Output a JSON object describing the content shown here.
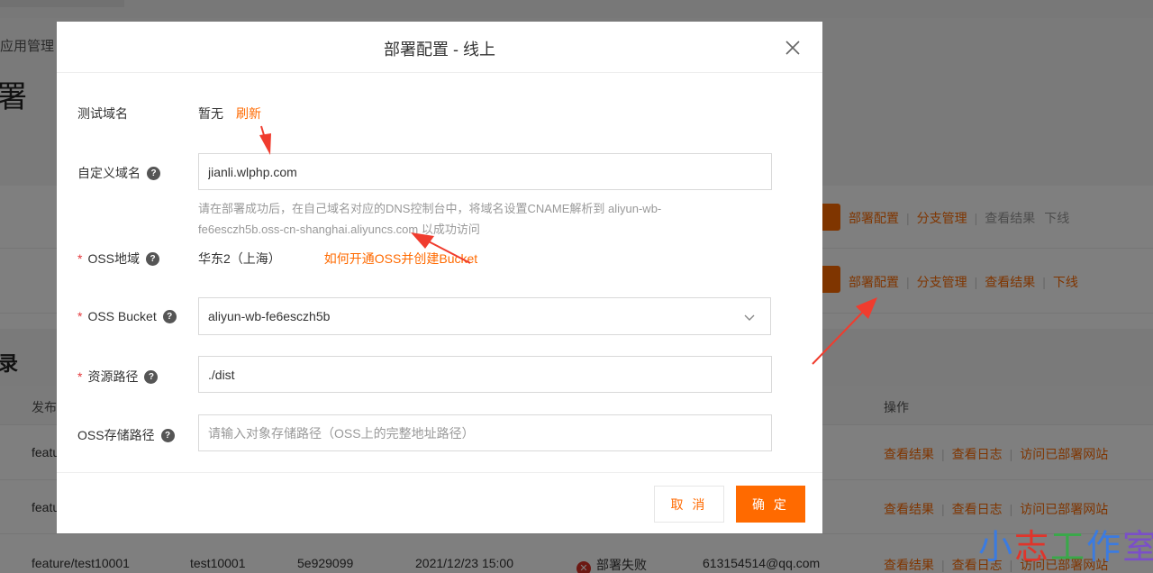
{
  "background": {
    "breadcrumb": "应用管理",
    "page_title_fragment": "署",
    "section_title_fragment": "录",
    "rows": [
      {
        "actions": [
          {
            "label": "部署配置",
            "style": "orange"
          },
          {
            "label": "分支管理",
            "style": "orange"
          },
          {
            "label": "查看结果",
            "style": "gray"
          },
          {
            "label": "下线",
            "style": "gray"
          }
        ]
      },
      {
        "actions": [
          {
            "label": "部署配置",
            "style": "orange"
          },
          {
            "label": "分支管理",
            "style": "orange"
          },
          {
            "label": "查看结果",
            "style": "orange"
          },
          {
            "label": "下线",
            "style": "orange"
          }
        ]
      }
    ],
    "table": {
      "headers": {
        "publish": "发布",
        "operation": "操作"
      },
      "row_actions": [
        "查看结果",
        "查看日志",
        "访问已部署网站"
      ],
      "rows": [
        {
          "branch": "featu"
        },
        {
          "branch": "featu"
        },
        {
          "branch": "feature/test10001",
          "name": "test10001",
          "commit": "5e929099",
          "time": "2021/12/23 15:00",
          "status": "部署失败",
          "email": "613154514@qq.com"
        }
      ]
    }
  },
  "modal": {
    "title": "部署配置 - 线上",
    "close_icon": "close-icon",
    "fields": {
      "test_domain": {
        "label": "测试域名",
        "value": "暂无",
        "link": "刷新"
      },
      "custom_domain": {
        "label": "自定义域名",
        "value": "jianli.wlphp.com",
        "hint_line1": "请在部署成功后，在自己域名对应的DNS控制台中，将域名设置CNAME解析到 aliyun-wb-",
        "hint_line2": "fe6esczh5b.oss-cn-shanghai.aliyuncs.com 以成功访问"
      },
      "oss_region": {
        "label": "OSS地域",
        "value": "华东2（上海）",
        "link": "如何开通OSS并创建Bucket"
      },
      "oss_bucket": {
        "label": "OSS Bucket",
        "value": "aliyun-wb-fe6esczh5b"
      },
      "resource_path": {
        "label": "资源路径",
        "value": "./dist"
      },
      "oss_storage_path": {
        "label": "OSS存储路径",
        "value": "",
        "placeholder": "请输入对象存储路径（OSS上的完整地址路径）"
      }
    },
    "buttons": {
      "cancel": "取 消",
      "ok": "确 定"
    }
  },
  "watermark": {
    "chars": [
      "小",
      "志",
      "工",
      "作",
      "室"
    ],
    "colors": [
      "#3b7be0",
      "#e0352b",
      "#3aa84a",
      "#3b7be0",
      "#7b4fc8"
    ]
  },
  "colors": {
    "accent": "#ff6a00",
    "required": "#e4393c",
    "arrow": "#f03c2e"
  }
}
